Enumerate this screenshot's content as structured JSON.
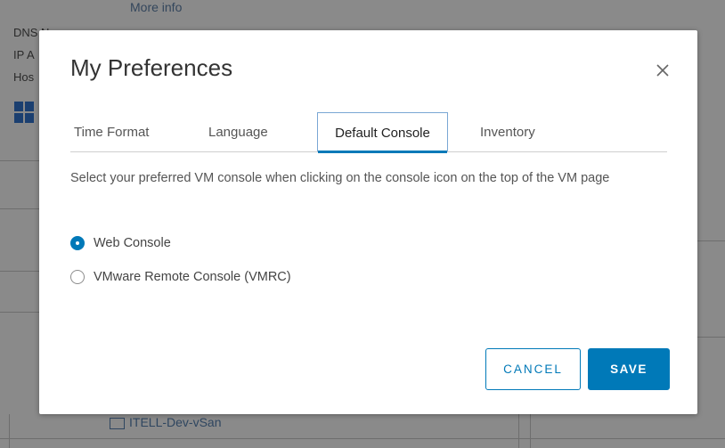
{
  "background": {
    "more_info": "More info",
    "labels": [
      "DNS Name:",
      "IP A",
      "Hos"
    ],
    "host_link": "ITELL-Dev-vSan"
  },
  "modal": {
    "title": "My Preferences",
    "tabs": [
      {
        "label": "Time Format",
        "active": false
      },
      {
        "label": "Language",
        "active": false
      },
      {
        "label": "Default Console",
        "active": true
      },
      {
        "label": "Inventory",
        "active": false
      }
    ],
    "description": "Select your preferred VM console when clicking on the console icon on the top of the VM page",
    "options": [
      {
        "label": "Web Console",
        "checked": true
      },
      {
        "label": "VMware Remote Console (VMRC)",
        "checked": false
      }
    ],
    "buttons": {
      "cancel": "CANCEL",
      "save": "SAVE"
    }
  },
  "colors": {
    "accent": "#0079b8",
    "overlay": "#8a8a8a"
  },
  "icons": {
    "close": "close-icon",
    "os": "windows-icon",
    "host": "storage-icon"
  }
}
